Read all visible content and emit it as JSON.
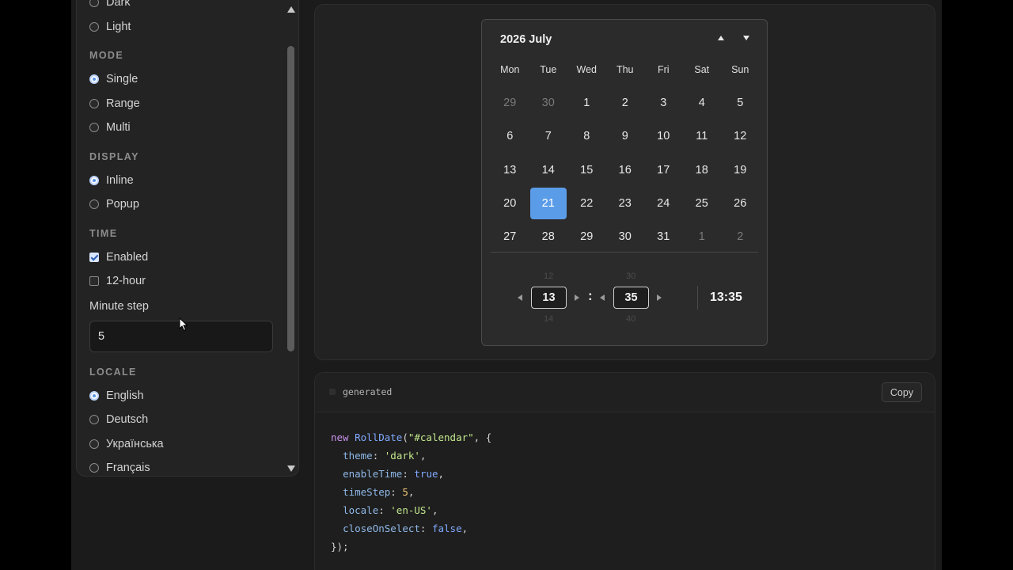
{
  "settings": {
    "theme_partial_option": "Dark",
    "theme_option_light": "Light",
    "mode": {
      "title": "MODE",
      "options": [
        "Single",
        "Range",
        "Multi"
      ]
    },
    "display": {
      "title": "DISPLAY",
      "options": [
        "Inline",
        "Popup"
      ]
    },
    "time": {
      "title": "TIME",
      "enabled_label": "Enabled",
      "twelve_hour_label": "12-hour",
      "minute_step_label": "Minute step",
      "minute_step_value": "5"
    },
    "locale": {
      "title": "LOCALE",
      "options": [
        "English",
        "Deutsch",
        "Українська",
        "Français"
      ]
    }
  },
  "calendar": {
    "title": "2026 July",
    "weekdays": [
      "Mon",
      "Tue",
      "Wed",
      "Thu",
      "Fri",
      "Sat",
      "Sun"
    ],
    "days": [
      {
        "label": "29",
        "muted": true
      },
      {
        "label": "30",
        "muted": true
      },
      {
        "label": "1"
      },
      {
        "label": "2"
      },
      {
        "label": "3"
      },
      {
        "label": "4"
      },
      {
        "label": "5"
      },
      {
        "label": "6"
      },
      {
        "label": "7"
      },
      {
        "label": "8"
      },
      {
        "label": "9"
      },
      {
        "label": "10"
      },
      {
        "label": "11"
      },
      {
        "label": "12"
      },
      {
        "label": "13"
      },
      {
        "label": "14"
      },
      {
        "label": "15"
      },
      {
        "label": "16"
      },
      {
        "label": "17"
      },
      {
        "label": "18"
      },
      {
        "label": "19"
      },
      {
        "label": "20"
      },
      {
        "label": "21",
        "selected": true
      },
      {
        "label": "22"
      },
      {
        "label": "23"
      },
      {
        "label": "24"
      },
      {
        "label": "25"
      },
      {
        "label": "26"
      },
      {
        "label": "27"
      },
      {
        "label": "28"
      },
      {
        "label": "29"
      },
      {
        "label": "30"
      },
      {
        "label": "31"
      },
      {
        "label": "1",
        "muted": true
      },
      {
        "label": "2",
        "muted": true
      }
    ],
    "time": {
      "hour_prev": "12",
      "hour": "13",
      "hour_next": "14",
      "minute_prev": "30",
      "minute": "35",
      "minute_next": "40",
      "separator": ":",
      "readout": "13:35"
    }
  },
  "code_panel": {
    "label": "generated",
    "copy_label": "Copy"
  },
  "colors": {
    "accent": "#5b9ce8",
    "background": "#1b1b1b",
    "panel": "#232323"
  }
}
